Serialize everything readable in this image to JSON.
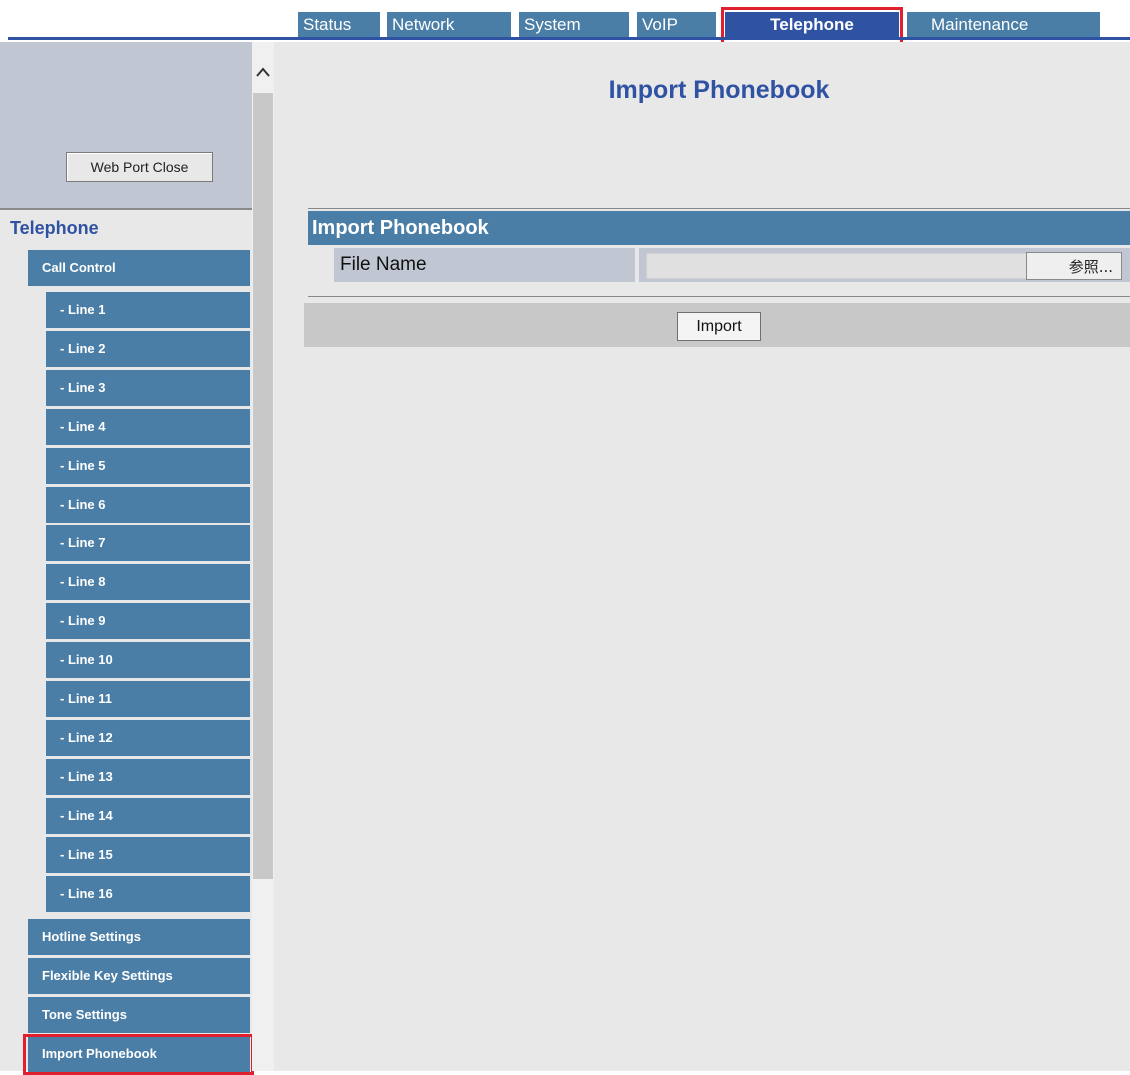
{
  "nav": {
    "tabs": [
      {
        "label": "Status"
      },
      {
        "label": "Network"
      },
      {
        "label": "System"
      },
      {
        "label": "VoIP"
      },
      {
        "label": "Telephone",
        "active": true
      },
      {
        "label": "Maintenance"
      }
    ]
  },
  "sidebar": {
    "web_port_button": "Web Port Close",
    "section_title": "Telephone",
    "call_control": "Call Control",
    "lines": [
      "- Line 1",
      "- Line 2",
      "- Line 3",
      "- Line 4",
      "- Line 5",
      "- Line 6",
      "- Line 7",
      "- Line 8",
      "- Line 9",
      "- Line 10",
      "- Line 11",
      "- Line 12",
      "- Line 13",
      "- Line 14",
      "- Line 15",
      "- Line 16"
    ],
    "items": [
      "Hotline Settings",
      "Flexible Key Settings",
      "Tone Settings",
      "Import Phonebook"
    ],
    "scroll_up_icon": "chevron-up-icon"
  },
  "main": {
    "page_title": "Import Phonebook",
    "section_header": "Import Phonebook",
    "file_name_label": "File Name",
    "browse_label": "参照...",
    "import_button": "Import"
  },
  "colors": {
    "accent": "#2f52a3",
    "bar": "#4a7ea6",
    "highlight": "#e0202c"
  }
}
